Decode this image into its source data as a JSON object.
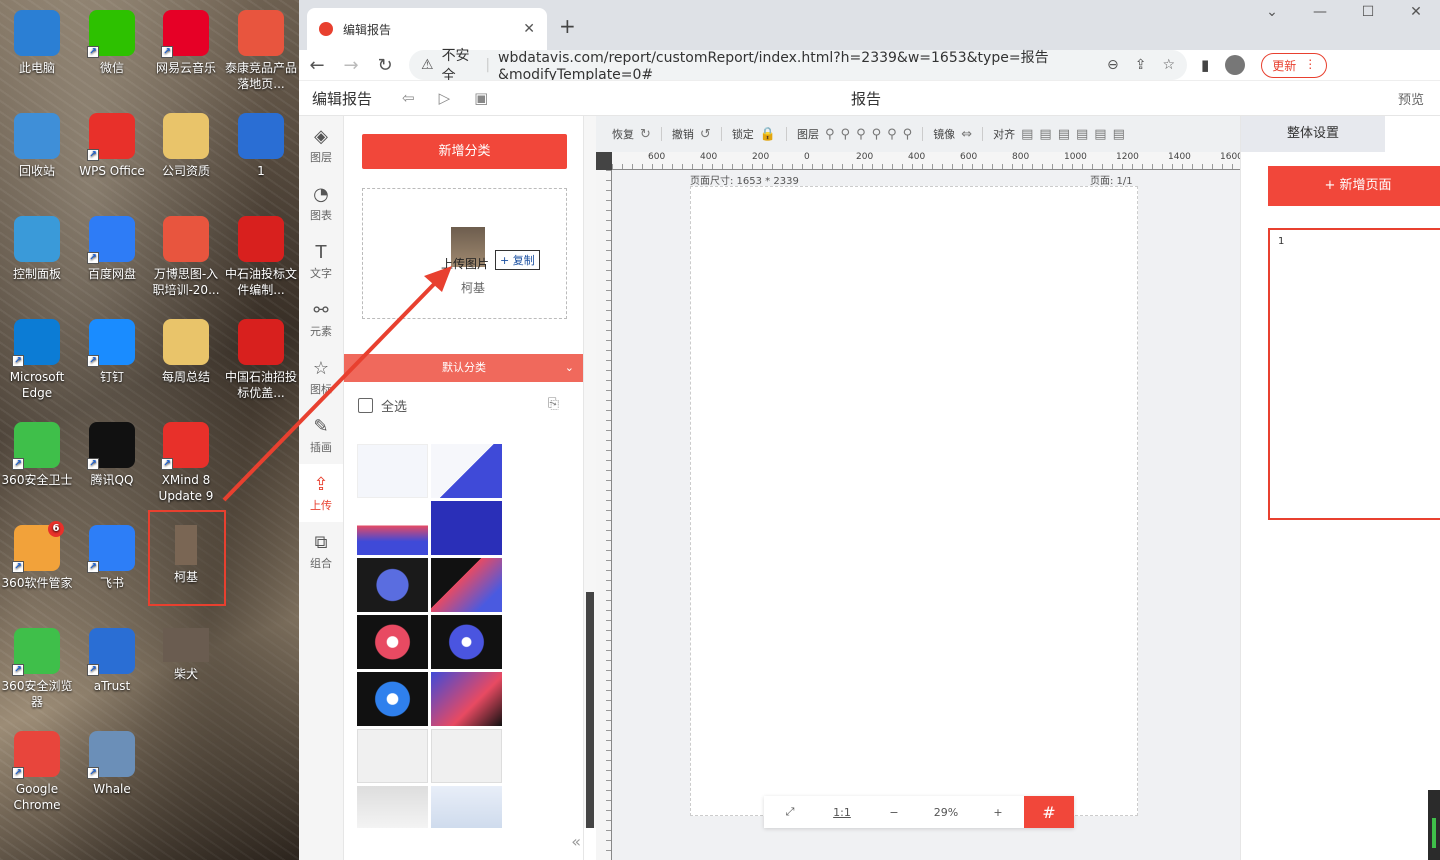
{
  "desktop": {
    "icons": [
      {
        "label": "此电脑",
        "icon": "computer-icon",
        "color": "#2b7fd4"
      },
      {
        "label": "微信",
        "icon": "wechat-icon",
        "color": "#2dc100"
      },
      {
        "label": "网易云音乐",
        "icon": "netease-music-icon",
        "color": "#e60026"
      },
      {
        "label": "泰康竞品产品落地页...",
        "icon": "pdf-file-icon",
        "color": "#e8553e"
      },
      {
        "label": "回收站",
        "icon": "recycle-bin-icon",
        "color": "#3f8fd8"
      },
      {
        "label": "WPS Office",
        "icon": "wps-icon",
        "color": "#e8302a"
      },
      {
        "label": "公司资质",
        "icon": "folder-icon",
        "color": "#e9c46a"
      },
      {
        "label": "1",
        "icon": "word-file-icon",
        "color": "#2a6ed4"
      },
      {
        "label": "控制面板",
        "icon": "control-panel-icon",
        "color": "#3a9ad9"
      },
      {
        "label": "百度网盘",
        "icon": "baidu-netdisk-icon",
        "color": "#2e7cf6"
      },
      {
        "label": "万博思图-入职培训-20...",
        "icon": "ppt-file-icon",
        "color": "#e8553e"
      },
      {
        "label": "中石油投标文件编制...",
        "icon": "petrochina-icon",
        "color": "#d8201e"
      },
      {
        "label": "Microsoft Edge",
        "icon": "edge-icon",
        "color": "#0c7cd5"
      },
      {
        "label": "钉钉",
        "icon": "dingtalk-icon",
        "color": "#1a8cff"
      },
      {
        "label": "每周总结",
        "icon": "folder-icon",
        "color": "#e9c46a"
      },
      {
        "label": "中国石油招投标优盖...",
        "icon": "petrochina-icon",
        "color": "#d8201e"
      },
      {
        "label": "360安全卫士",
        "icon": "360-safe-icon",
        "color": "#3fbf4a"
      },
      {
        "label": "腾讯QQ",
        "icon": "qq-icon",
        "color": "#111111"
      },
      {
        "label": "XMind 8 Update 9",
        "icon": "xmind-icon",
        "color": "#e8302a"
      },
      {
        "label": "",
        "icon": "",
        "color": ""
      },
      {
        "label": "360软件管家",
        "icon": "360-software-icon",
        "color": "#f2a23a"
      },
      {
        "label": "飞书",
        "icon": "feishu-icon",
        "color": "#2d7ef7"
      },
      {
        "label": "柯基",
        "icon": "corgi-image-icon",
        "color": "#7a6654"
      },
      {
        "label": "",
        "icon": "",
        "color": ""
      },
      {
        "label": "360安全浏览器",
        "icon": "360-browser-icon",
        "color": "#3fbf4a"
      },
      {
        "label": "aTrust",
        "icon": "atrust-icon",
        "color": "#2a6ed4"
      },
      {
        "label": "柴犬",
        "icon": "shiba-image-icon",
        "color": "#6a5c50"
      },
      {
        "label": "",
        "icon": "",
        "color": ""
      },
      {
        "label": "Google Chrome",
        "icon": "chrome-icon",
        "color": "#e8453c"
      },
      {
        "label": "Whale",
        "icon": "whale-icon",
        "color": "#6b8fb8"
      }
    ],
    "badge_360": "6"
  },
  "browser": {
    "tab_title": "编辑报告",
    "insecure": "不安全",
    "url": "wbdatavis.com/report/customReport/index.html?h=2339&w=1653&type=报告&modifyTemplate=0#",
    "update_label": "更新"
  },
  "app": {
    "title": "编辑报告",
    "center_title": "报告",
    "preview": "预览",
    "sidebar": [
      {
        "label": "图层",
        "icon": "layers-icon"
      },
      {
        "label": "图表",
        "icon": "chart-icon"
      },
      {
        "label": "文字",
        "icon": "text-icon"
      },
      {
        "label": "元素",
        "icon": "elements-icon"
      },
      {
        "label": "图标",
        "icon": "star-icon"
      },
      {
        "label": "插画",
        "icon": "illustration-icon"
      },
      {
        "label": "上传",
        "icon": "upload-icon"
      },
      {
        "label": "组合",
        "icon": "group-icon"
      }
    ],
    "panel": {
      "add_category": "新增分类",
      "upload_label": "上传图片",
      "dragged_name": "柯基",
      "copy_label": "+ 复制",
      "category": "默认分类",
      "select_all": "全选"
    },
    "toolbar": [
      "恢复",
      "撤销",
      "锁定",
      "图层",
      "镜像",
      "对齐"
    ],
    "ruler_ticks": [
      "600",
      "400",
      "200",
      "0",
      "200",
      "400",
      "600",
      "800",
      "1000",
      "1200",
      "1400",
      "1600"
    ],
    "page_size": "页面尺寸: 1653 * 2339",
    "page_num": "页面: 1/1",
    "zoom": {
      "fit": "⤢",
      "one": "1:1",
      "minus": "−",
      "value": "29%",
      "plus": "+"
    },
    "right": {
      "tab": "整体设置",
      "add_page": "+ 新增页面",
      "page_label": "1"
    }
  }
}
